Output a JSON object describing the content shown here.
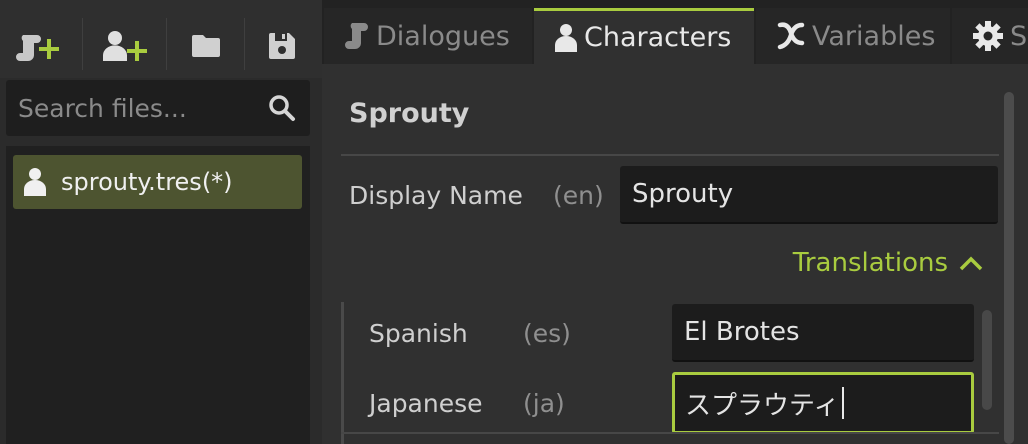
{
  "toolbar": {
    "buttons": [
      {
        "icon": "new-dialogue-icon"
      },
      {
        "icon": "new-character-icon"
      },
      {
        "icon": "folder-icon"
      },
      {
        "icon": "save-icon"
      }
    ]
  },
  "search": {
    "placeholder": "Search files...",
    "value": ""
  },
  "files": [
    {
      "label": "sprouty.tres(*)",
      "icon": "person-icon"
    }
  ],
  "tabs": [
    {
      "label": "Dialogues",
      "icon": "dialogue-icon"
    },
    {
      "label": "Characters",
      "icon": "person-icon"
    },
    {
      "label": "Variables",
      "icon": "variable-x-icon"
    },
    {
      "label": "S",
      "icon": "gear-icon"
    }
  ],
  "character": {
    "name": "Sprouty",
    "display_name_label": "Display Name",
    "display_name_lang": "(en)",
    "display_name_value": "Sprouty",
    "translations_label": "Translations",
    "translations": [
      {
        "language": "Spanish",
        "code": "(es)",
        "value": "El Brotes"
      },
      {
        "language": "Japanese",
        "code": "(ja)",
        "value": "スプラウティ"
      }
    ]
  },
  "colors": {
    "accent": "#a9cc3f",
    "selected_file_bg": "#4d5430"
  }
}
